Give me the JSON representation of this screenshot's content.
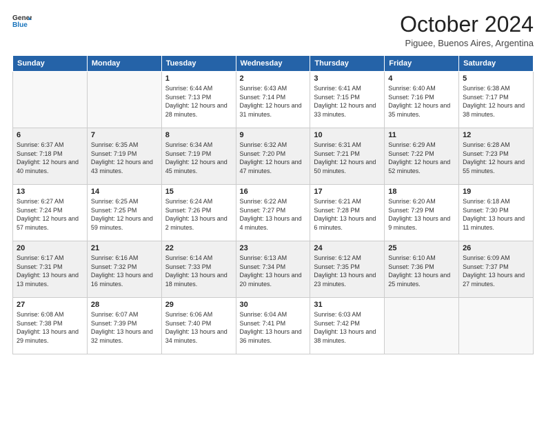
{
  "header": {
    "logo_line1": "General",
    "logo_line2": "Blue",
    "month": "October 2024",
    "location": "Piguee, Buenos Aires, Argentina"
  },
  "weekdays": [
    "Sunday",
    "Monday",
    "Tuesday",
    "Wednesday",
    "Thursday",
    "Friday",
    "Saturday"
  ],
  "weeks": [
    [
      {
        "day": "",
        "info": ""
      },
      {
        "day": "",
        "info": ""
      },
      {
        "day": "1",
        "info": "Sunrise: 6:44 AM\nSunset: 7:13 PM\nDaylight: 12 hours and 28 minutes."
      },
      {
        "day": "2",
        "info": "Sunrise: 6:43 AM\nSunset: 7:14 PM\nDaylight: 12 hours and 31 minutes."
      },
      {
        "day": "3",
        "info": "Sunrise: 6:41 AM\nSunset: 7:15 PM\nDaylight: 12 hours and 33 minutes."
      },
      {
        "day": "4",
        "info": "Sunrise: 6:40 AM\nSunset: 7:16 PM\nDaylight: 12 hours and 35 minutes."
      },
      {
        "day": "5",
        "info": "Sunrise: 6:38 AM\nSunset: 7:17 PM\nDaylight: 12 hours and 38 minutes."
      }
    ],
    [
      {
        "day": "6",
        "info": "Sunrise: 6:37 AM\nSunset: 7:18 PM\nDaylight: 12 hours and 40 minutes."
      },
      {
        "day": "7",
        "info": "Sunrise: 6:35 AM\nSunset: 7:19 PM\nDaylight: 12 hours and 43 minutes."
      },
      {
        "day": "8",
        "info": "Sunrise: 6:34 AM\nSunset: 7:19 PM\nDaylight: 12 hours and 45 minutes."
      },
      {
        "day": "9",
        "info": "Sunrise: 6:32 AM\nSunset: 7:20 PM\nDaylight: 12 hours and 47 minutes."
      },
      {
        "day": "10",
        "info": "Sunrise: 6:31 AM\nSunset: 7:21 PM\nDaylight: 12 hours and 50 minutes."
      },
      {
        "day": "11",
        "info": "Sunrise: 6:29 AM\nSunset: 7:22 PM\nDaylight: 12 hours and 52 minutes."
      },
      {
        "day": "12",
        "info": "Sunrise: 6:28 AM\nSunset: 7:23 PM\nDaylight: 12 hours and 55 minutes."
      }
    ],
    [
      {
        "day": "13",
        "info": "Sunrise: 6:27 AM\nSunset: 7:24 PM\nDaylight: 12 hours and 57 minutes."
      },
      {
        "day": "14",
        "info": "Sunrise: 6:25 AM\nSunset: 7:25 PM\nDaylight: 12 hours and 59 minutes."
      },
      {
        "day": "15",
        "info": "Sunrise: 6:24 AM\nSunset: 7:26 PM\nDaylight: 13 hours and 2 minutes."
      },
      {
        "day": "16",
        "info": "Sunrise: 6:22 AM\nSunset: 7:27 PM\nDaylight: 13 hours and 4 minutes."
      },
      {
        "day": "17",
        "info": "Sunrise: 6:21 AM\nSunset: 7:28 PM\nDaylight: 13 hours and 6 minutes."
      },
      {
        "day": "18",
        "info": "Sunrise: 6:20 AM\nSunset: 7:29 PM\nDaylight: 13 hours and 9 minutes."
      },
      {
        "day": "19",
        "info": "Sunrise: 6:18 AM\nSunset: 7:30 PM\nDaylight: 13 hours and 11 minutes."
      }
    ],
    [
      {
        "day": "20",
        "info": "Sunrise: 6:17 AM\nSunset: 7:31 PM\nDaylight: 13 hours and 13 minutes."
      },
      {
        "day": "21",
        "info": "Sunrise: 6:16 AM\nSunset: 7:32 PM\nDaylight: 13 hours and 16 minutes."
      },
      {
        "day": "22",
        "info": "Sunrise: 6:14 AM\nSunset: 7:33 PM\nDaylight: 13 hours and 18 minutes."
      },
      {
        "day": "23",
        "info": "Sunrise: 6:13 AM\nSunset: 7:34 PM\nDaylight: 13 hours and 20 minutes."
      },
      {
        "day": "24",
        "info": "Sunrise: 6:12 AM\nSunset: 7:35 PM\nDaylight: 13 hours and 23 minutes."
      },
      {
        "day": "25",
        "info": "Sunrise: 6:10 AM\nSunset: 7:36 PM\nDaylight: 13 hours and 25 minutes."
      },
      {
        "day": "26",
        "info": "Sunrise: 6:09 AM\nSunset: 7:37 PM\nDaylight: 13 hours and 27 minutes."
      }
    ],
    [
      {
        "day": "27",
        "info": "Sunrise: 6:08 AM\nSunset: 7:38 PM\nDaylight: 13 hours and 29 minutes."
      },
      {
        "day": "28",
        "info": "Sunrise: 6:07 AM\nSunset: 7:39 PM\nDaylight: 13 hours and 32 minutes."
      },
      {
        "day": "29",
        "info": "Sunrise: 6:06 AM\nSunset: 7:40 PM\nDaylight: 13 hours and 34 minutes."
      },
      {
        "day": "30",
        "info": "Sunrise: 6:04 AM\nSunset: 7:41 PM\nDaylight: 13 hours and 36 minutes."
      },
      {
        "day": "31",
        "info": "Sunrise: 6:03 AM\nSunset: 7:42 PM\nDaylight: 13 hours and 38 minutes."
      },
      {
        "day": "",
        "info": ""
      },
      {
        "day": "",
        "info": ""
      }
    ]
  ]
}
